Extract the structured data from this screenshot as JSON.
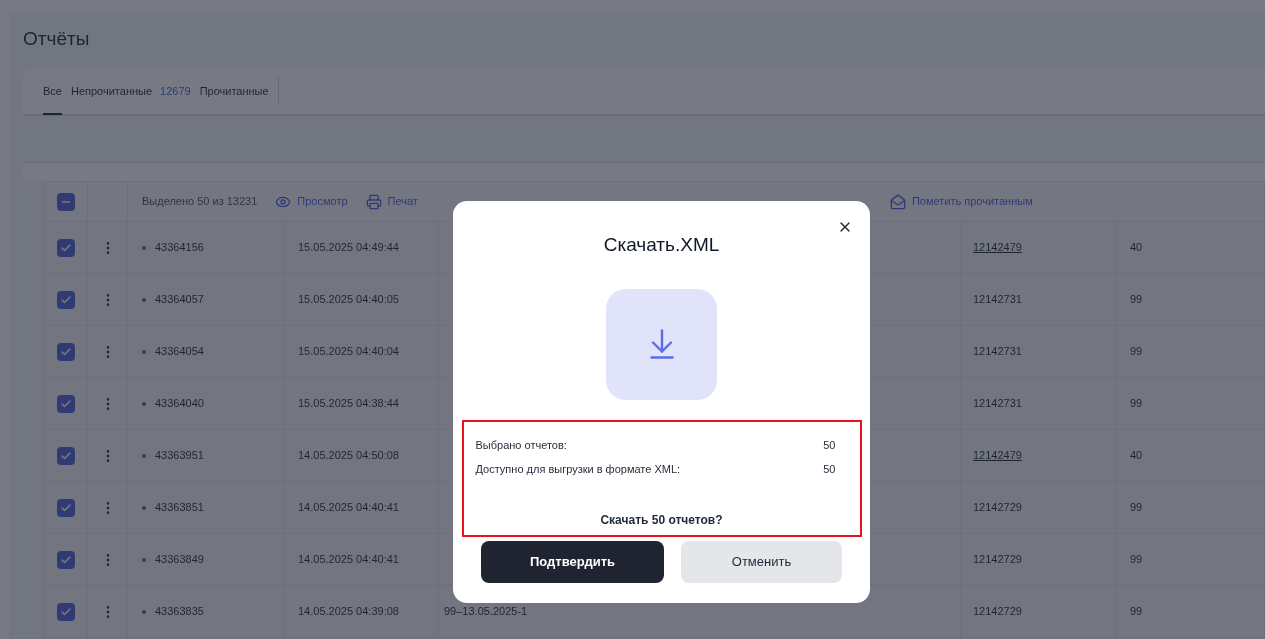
{
  "page_title": "Отчёты",
  "tabs": [
    {
      "label": "Все",
      "selected": true
    },
    {
      "label": "Непрочитанные",
      "count": "12679",
      "selected": false
    },
    {
      "label": "Прочитанные",
      "selected": false
    }
  ],
  "toolbar": {
    "select_all_checked": true,
    "select_all_partial": true,
    "selection_text": "Выделено 50 из 13231",
    "actions": [
      {
        "label": "Просмотр",
        "kind": "view"
      },
      {
        "label": "Печат",
        "kind": "print"
      },
      {
        "label": "Пометить прочитанным",
        "kind": "markread"
      }
    ]
  },
  "rows": [
    {
      "checked": true,
      "id": "43364156",
      "date": "15.05.2025 04:49:44",
      "number": "12142479",
      "linked": true,
      "value": "40"
    },
    {
      "checked": true,
      "id": "43364057",
      "date": "15.05.2025 04:40:05",
      "number": "12142731",
      "linked": false,
      "value": "99"
    },
    {
      "checked": true,
      "id": "43364054",
      "date": "15.05.2025 04:40:04",
      "number": "12142731",
      "linked": false,
      "value": "99"
    },
    {
      "checked": true,
      "id": "43364040",
      "date": "15.05.2025 04:38:44",
      "number": "12142731",
      "linked": false,
      "value": "99"
    },
    {
      "checked": true,
      "id": "43363951",
      "date": "14.05.2025 04:50:08",
      "number": "12142479",
      "linked": true,
      "value": "40"
    },
    {
      "checked": true,
      "id": "43363851",
      "date": "14.05.2025 04:40:41",
      "number": "12142729",
      "linked": false,
      "value": "99"
    },
    {
      "checked": true,
      "id": "43363849",
      "date": "14.05.2025 04:40:41",
      "number": "12142729",
      "linked": false,
      "value": "99"
    },
    {
      "checked": true,
      "id": "43363835",
      "date": "14.05.2025 04:39:08",
      "column_3": "99–13.05.2025-1",
      "number": "12142729",
      "linked": false,
      "value": "99"
    }
  ],
  "modal": {
    "title": "Скачать.XML",
    "stats": [
      {
        "label": "Выбрано отчетов:",
        "value": "50"
      },
      {
        "label": "Доступно для выгрузки в формате XML:",
        "value": "50"
      }
    ],
    "question": "Скачать 50 отчетов?",
    "confirm": "Подтвердить",
    "cancel": "Отменить"
  }
}
